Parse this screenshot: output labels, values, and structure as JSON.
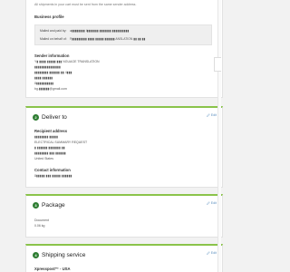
{
  "top_card": {
    "note": "All shipments in your cart must be sent from the same sender address.",
    "business_profile_label": "Business profile",
    "business_profile": {
      "rows": [
        {
          "key": "Mailed and paid by:",
          "value": "a▮▮▮▮▮▮▮▮ I▮▮▮▮▮▮▮ ▮▮▮▮▮▮▮ ▮▮▮▮▮▮▮▮▮▮"
        },
        {
          "key": "Mailed on behalf of:",
          "value": "F▮▮▮▮▮▮▮▮▮ ▮▮▮▮ ▮▮▮▮▮ ▮▮▮▮▮▮ ANSLATION ▮▮ ▮▮ ▮▮"
        }
      ]
    },
    "sender_label": "Sender information",
    "sender_lines": [
      "Y▮ ▮▮▮▮ ▮▮▮▮▮ ▮▮▮ NGUAGE TRANSLATION",
      "▮▮▮▮▮▮▮▮▮▮▮▮▮▮▮",
      "▮▮▮▮▮▮▮▮ ▮▮▮▮▮▮ ▮▮ 4▮▮▮",
      "▮▮▮▮ ▮▮▮▮▮▮",
      "8▮▮▮▮▮▮▮▮▮▮",
      "bg.▮▮▮▮▮▮@gmail.com"
    ]
  },
  "deliver": {
    "step": "2",
    "title": "Deliver to",
    "edit": "Edit",
    "recipient_label": "Recipient address",
    "recipient_lines": [
      "▮▮▮▮▮▮▮▮ ▮▮▮▮▮",
      "ELECTRICAL SUMMARY REQUEST",
      "▮ ▮▮▮▮▮▮ ▮▮▮▮▮▮▮ ▮▮",
      "▮▮▮▮▮▮▮▮ ▮▮▮ ▮▮▮▮▮▮",
      "United States"
    ],
    "contact_label": "Contact information",
    "contact_lines": [
      "8▮▮▮▮▮ ▮▮▮ ▮▮▮▮▮ ▮▮▮▮▮▮"
    ]
  },
  "package": {
    "step": "3",
    "title": "Package",
    "edit": "Edit",
    "lines": [
      "Document",
      "0.06 kg"
    ]
  },
  "shipping": {
    "step": "4",
    "title": "Shipping service",
    "edit": "Edit",
    "service": "Xpresspost™ - USA"
  },
  "colors": {
    "accent": "#2e7d32",
    "card_border_top": "#8ac34a",
    "link": "#5c8fbf"
  },
  "icons": {
    "edit": "pencil-icon"
  }
}
